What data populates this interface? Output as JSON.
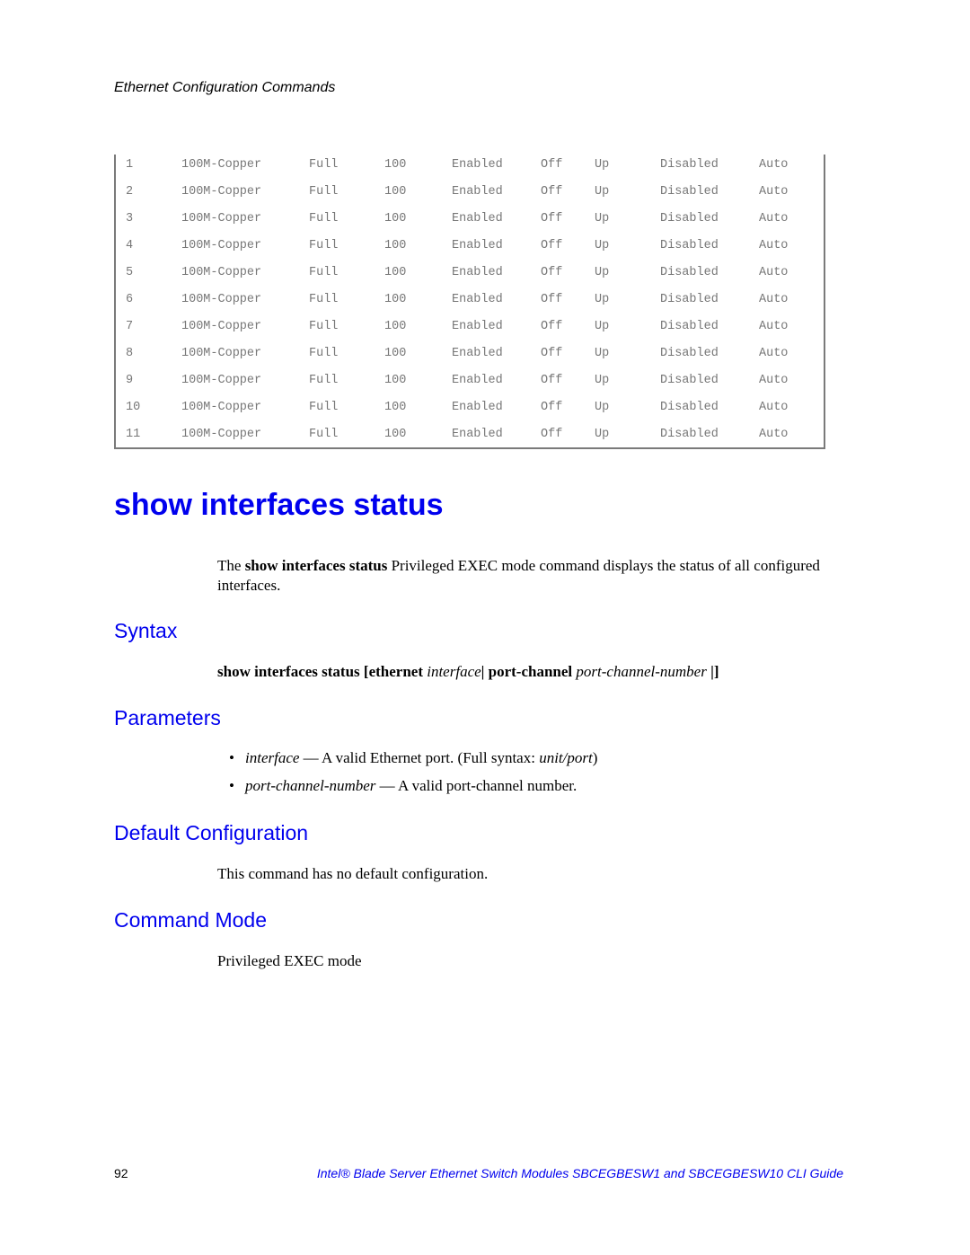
{
  "header": {
    "running_title": "Ethernet Configuration Commands"
  },
  "code_output": {
    "rows": [
      [
        "1",
        "100M-Copper",
        "Full",
        "100",
        "Enabled",
        "Off",
        "Up",
        "Disabled",
        "Auto"
      ],
      [
        "2",
        "100M-Copper",
        "Full",
        "100",
        "Enabled",
        "Off",
        "Up",
        "Disabled",
        "Auto"
      ],
      [
        "3",
        "100M-Copper",
        "Full",
        "100",
        "Enabled",
        "Off",
        "Up",
        "Disabled",
        "Auto"
      ],
      [
        "4",
        "100M-Copper",
        "Full",
        "100",
        "Enabled",
        "Off",
        "Up",
        "Disabled",
        "Auto"
      ],
      [
        "5",
        "100M-Copper",
        "Full",
        "100",
        "Enabled",
        "Off",
        "Up",
        "Disabled",
        "Auto"
      ],
      [
        "6",
        "100M-Copper",
        "Full",
        "100",
        "Enabled",
        "Off",
        "Up",
        "Disabled",
        "Auto"
      ],
      [
        "7",
        "100M-Copper",
        "Full",
        "100",
        "Enabled",
        "Off",
        "Up",
        "Disabled",
        "Auto"
      ],
      [
        "8",
        "100M-Copper",
        "Full",
        "100",
        "Enabled",
        "Off",
        "Up",
        "Disabled",
        "Auto"
      ],
      [
        "9",
        "100M-Copper",
        "Full",
        "100",
        "Enabled",
        "Off",
        "Up",
        "Disabled",
        "Auto"
      ],
      [
        "10",
        "100M-Copper",
        "Full",
        "100",
        "Enabled",
        "Off",
        "Up",
        "Disabled",
        "Auto"
      ],
      [
        "11",
        "100M-Copper",
        "Full",
        "100",
        "Enabled",
        "Off",
        "Up",
        "Disabled",
        "Auto"
      ]
    ]
  },
  "command": {
    "title": "show interfaces status",
    "description": {
      "prefix": "The ",
      "command_bold": "show interfaces status",
      "suffix": " Privileged EXEC mode command displays the status of all configured interfaces."
    }
  },
  "sections": {
    "syntax": {
      "heading": "Syntax",
      "parts": {
        "cmd": "show interfaces status [ethernet ",
        "arg1": "interface",
        "sep": "| port-channel ",
        "arg2": "port-channel-number ",
        "end": "|]"
      }
    },
    "parameters": {
      "heading": "Parameters",
      "items": [
        {
          "bullet": "•",
          "name": "interface",
          "desc": " — A valid Ethernet port. (Full syntax: ",
          "desc_italic": "unit/port",
          "desc_end": ")"
        },
        {
          "bullet": "•",
          "name": "port-channel-number",
          "desc": " — A valid port-channel number.",
          "desc_italic": "",
          "desc_end": ""
        }
      ]
    },
    "default_configuration": {
      "heading": "Default Configuration",
      "text": "This command has no default configuration."
    },
    "command_mode": {
      "heading": "Command Mode",
      "text": "Privileged EXEC mode"
    }
  },
  "footer": {
    "page_number": "92",
    "book_title": "Intel® Blade Server Ethernet Switch Modules SBCEGBESW1 and SBCEGBESW10 CLI Guide"
  }
}
